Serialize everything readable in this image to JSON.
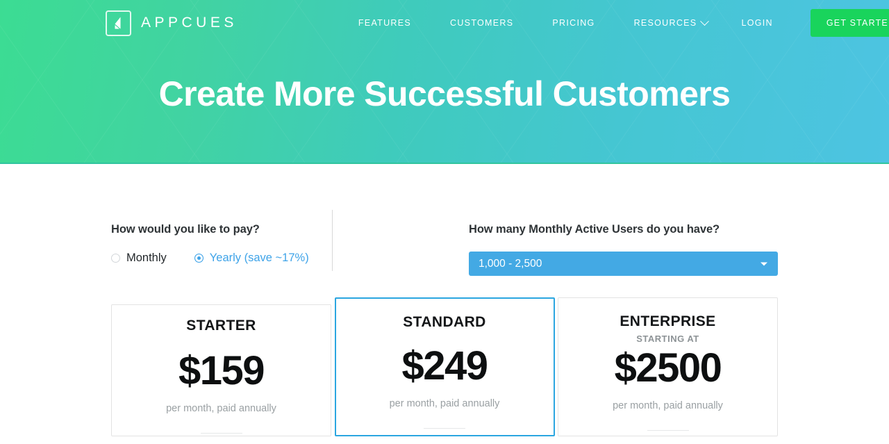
{
  "header": {
    "logo_text": "APPCUES",
    "nav": [
      {
        "label": "FEATURES"
      },
      {
        "label": "CUSTOMERS"
      },
      {
        "label": "PRICING"
      },
      {
        "label": "RESOURCES"
      },
      {
        "label": "LOGIN"
      }
    ],
    "cta_label": "GET STARTED"
  },
  "hero": {
    "title": "Create More Successful Customers"
  },
  "billing": {
    "question": "How would you like to pay?",
    "options": [
      {
        "label": "Monthly",
        "selected": false
      },
      {
        "label": "Yearly (save ~17%)",
        "selected": true
      }
    ]
  },
  "mau": {
    "question": "How many Monthly Active Users do you have?",
    "selected": "1,000 - 2,500"
  },
  "plans": [
    {
      "name": "STARTER",
      "subtitle": "",
      "price": "$159",
      "period": "per month, paid annually",
      "featured": false
    },
    {
      "name": "STANDARD",
      "subtitle": "",
      "price": "$249",
      "period": "per month, paid annually",
      "featured": true
    },
    {
      "name": "ENTERPRISE",
      "subtitle": "STARTING AT",
      "price": "$2500",
      "period": "per month, paid annually",
      "featured": false
    }
  ],
  "colors": {
    "gradient_start": "#3cdc93",
    "gradient_end": "#4dc4e2",
    "cta_green": "#19d45c",
    "accent_blue": "#43a9e4",
    "featured_border": "#2ba6e0"
  }
}
